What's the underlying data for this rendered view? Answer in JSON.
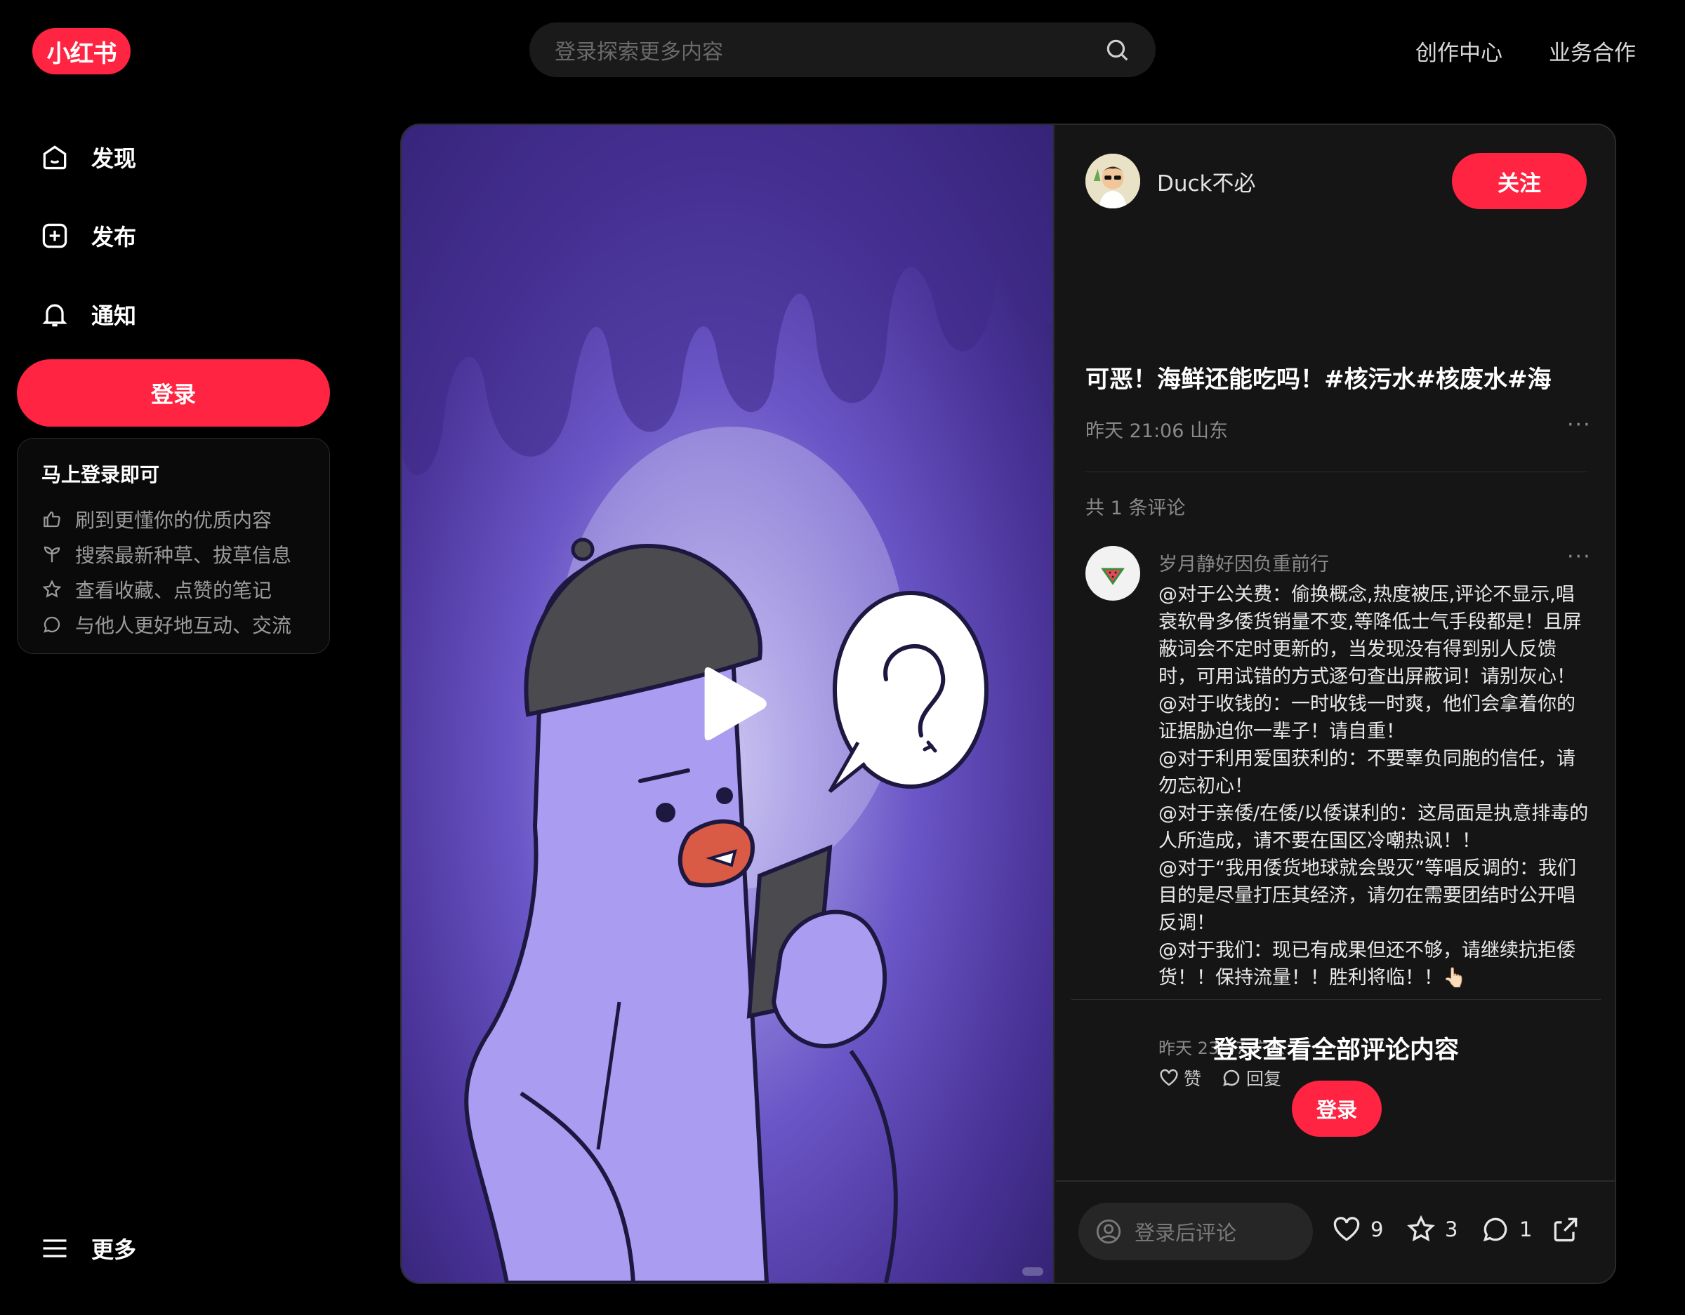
{
  "header": {
    "logo_text": "小红书",
    "search_placeholder": "登录探索更多内容",
    "nav": [
      "创作中心",
      "业务合作"
    ]
  },
  "sidebar": {
    "items": [
      {
        "label": "发现",
        "icon": "home-icon"
      },
      {
        "label": "发布",
        "icon": "plus-square-icon"
      },
      {
        "label": "通知",
        "icon": "bell-icon"
      }
    ],
    "login_button": "登录",
    "login_card": {
      "title": "马上登录即可",
      "rows": [
        {
          "icon": "thumbs-up-icon",
          "text": "刷到更懂你的优质内容"
        },
        {
          "icon": "sprout-icon",
          "text": "搜索最新种草、拔草信息"
        },
        {
          "icon": "star-icon",
          "text": "查看收藏、点赞的笔记"
        },
        {
          "icon": "chat-bubble-icon",
          "text": "与他人更好地互动、交流"
        }
      ]
    },
    "more_label": "更多"
  },
  "note": {
    "author": "Duck不必",
    "follow_label": "关注",
    "title": "可恶！海鲜还能吃吗！#核污水#核废水#海",
    "meta": "昨天 21:06 山东",
    "comment_count_label": "共 1 条评论",
    "comment": {
      "user": "岁月静好因负重前行",
      "lines": [
        "@对于公关费：偷换概念,热度被压,评论不显示,唱衰软骨多倭货销量不变,等降低士气手段都是！且屏蔽词会不定时更新的，当发现没有得到别人反馈时，可用试错的方式逐句查出屏蔽词！请别灰心！",
        "@对于收钱的：一时收钱一时爽，他们会拿着你的证据胁迫你一辈子！请自重！",
        "@对于利用爱国获利的：不要辜负同胞的信任，请勿忘初心！",
        "@对于亲倭/在倭/以倭谋利的：这局面是执意排毒的人所造成，请不要在国区冷嘲热讽！！",
        "@对于“我用倭货地球就会毁灭”等唱反调的：我们目的是尽量打压其经济，请勿在需要团结时公开唱反调！",
        "@对于我们：现已有成果但还不够，请继续抗拒倭货！！保持流量！！胜利将临！！👆🏻"
      ],
      "time": "昨天 23:37 广东",
      "like_label": "赞",
      "reply_label": "回复"
    },
    "login_prompt": "登录查看全部评论内容",
    "login_button": "登录",
    "comment_input_placeholder": "登录后评论",
    "stats": {
      "likes": "9",
      "collects": "3",
      "comments": "1"
    }
  },
  "colors": {
    "accent": "#ff2442",
    "background": "#000000",
    "panel": "#151515"
  }
}
